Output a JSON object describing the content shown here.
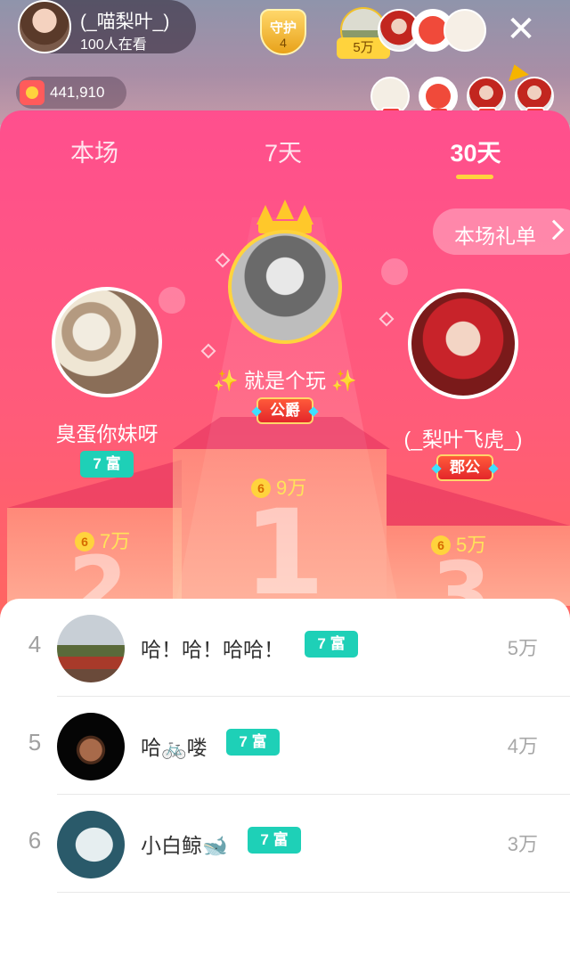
{
  "host": {
    "name": "(_喵梨叶_)",
    "viewers": "100人在看"
  },
  "guard": {
    "label": "守护",
    "count": "4"
  },
  "contribution": {
    "amount": "5万"
  },
  "coins": {
    "value": "441,910"
  },
  "tabs": [
    {
      "label": "本场"
    },
    {
      "label": "7天"
    },
    {
      "label": "30天"
    }
  ],
  "active_tab": "30天",
  "gift_list_button": "本场礼单",
  "podium": {
    "first": {
      "name": "✨ 就是个玩 ✨",
      "noble": "公爵",
      "amount": "9万",
      "rank_digit": "1"
    },
    "second": {
      "name": "臭蛋你妹呀",
      "rich": "7 富",
      "amount": "7万",
      "rank_digit": "2"
    },
    "third": {
      "name": "(_梨叶飞虎_)",
      "noble": "郡公",
      "amount": "5万",
      "rank_digit": "3"
    }
  },
  "coin_symbol": "6",
  "list": [
    {
      "rank": "4",
      "name": "哈！哈！哈哈！",
      "rich": "7 富",
      "amount": "5万"
    },
    {
      "rank": "5",
      "name": "哈🚲喽",
      "rich": "7 富",
      "amount": "4万"
    },
    {
      "rank": "6",
      "name": "小白鲸🐋",
      "rich": "7 富",
      "amount": "3万"
    }
  ],
  "colors": {
    "rich_tag": "#1ed0b7",
    "accent": "#ffd33d",
    "panel_top": "#ff4f8e",
    "panel_bottom": "#ff7a45"
  }
}
